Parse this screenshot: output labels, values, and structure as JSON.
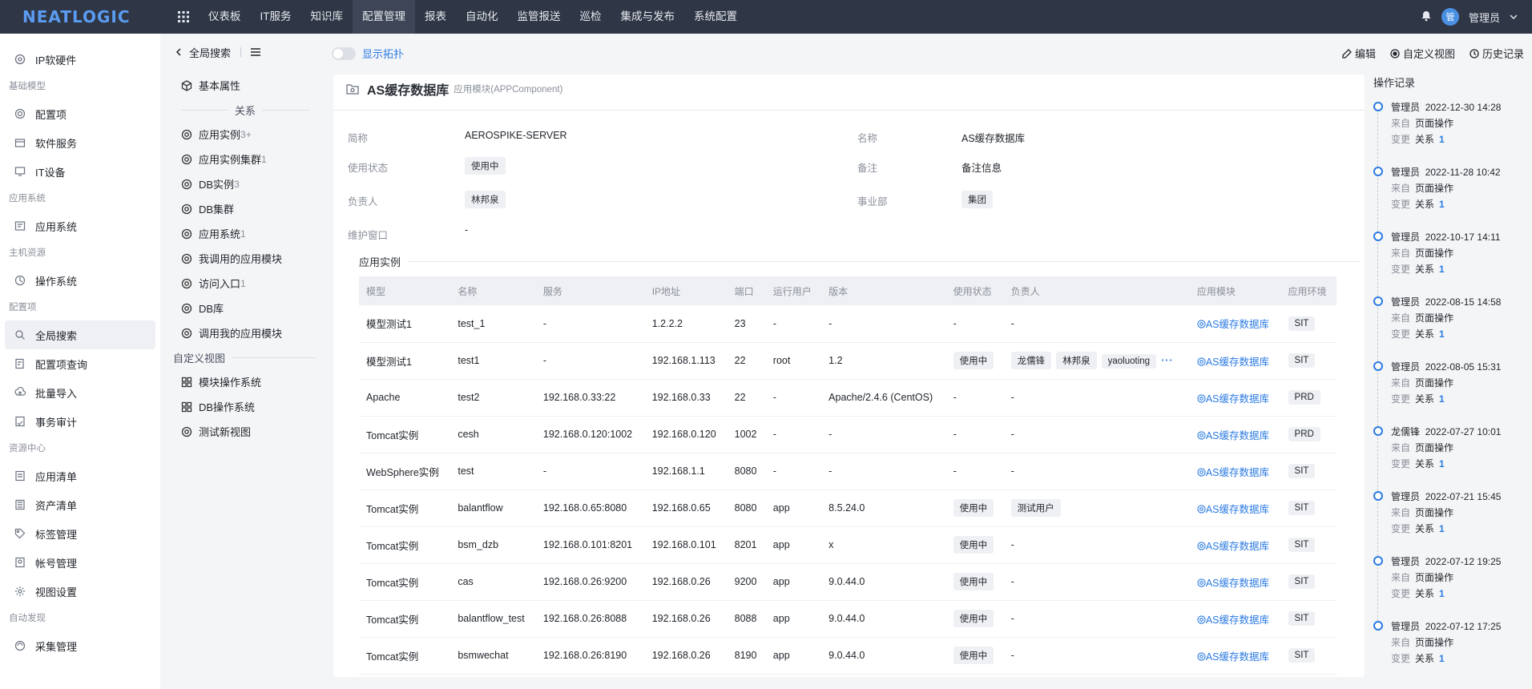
{
  "app": {
    "logo": "NEATLOGIC"
  },
  "topnav": [
    "仪表板",
    "IT服务",
    "知识库",
    "配置管理",
    "报表",
    "自动化",
    "监管报送",
    "巡检",
    "集成与发布",
    "系统配置"
  ],
  "user": {
    "avatar_text": "管",
    "name": "管理员"
  },
  "sidebar": {
    "top_item": "IP软硬件",
    "groups": [
      {
        "title": "基础模型",
        "items": [
          {
            "label": "配置项",
            "icon": "gear-icon"
          },
          {
            "label": "软件服务",
            "icon": "box-icon"
          },
          {
            "label": "IT设备",
            "icon": "monitor-icon"
          }
        ]
      },
      {
        "title": "应用系统",
        "items": [
          {
            "label": "应用系统",
            "icon": "app-icon"
          }
        ]
      },
      {
        "title": "主机资源",
        "items": [
          {
            "label": "操作系统",
            "icon": "os-icon"
          }
        ]
      },
      {
        "title": "配置项",
        "items": [
          {
            "label": "全局搜索",
            "icon": "search-icon",
            "active": true
          },
          {
            "label": "配置项查询",
            "icon": "query-icon"
          },
          {
            "label": "批量导入",
            "icon": "upload-icon"
          },
          {
            "label": "事务审计",
            "icon": "audit-icon"
          }
        ]
      },
      {
        "title": "资源中心",
        "items": [
          {
            "label": "应用清单",
            "icon": "list-icon"
          },
          {
            "label": "资产清单",
            "icon": "doc-icon"
          },
          {
            "label": "标签管理",
            "icon": "tag-icon"
          },
          {
            "label": "帐号管理",
            "icon": "account-icon"
          },
          {
            "label": "视图设置",
            "icon": "settings-icon"
          }
        ]
      },
      {
        "title": "自动发现",
        "items": [
          {
            "label": "采集管理",
            "icon": "collect-icon"
          }
        ]
      }
    ]
  },
  "breadcrumb": {
    "back_label": "全局搜索"
  },
  "relations_panel": {
    "basic_label": "基本属性",
    "relations_title": "关系",
    "relations": [
      {
        "label": "应用实例",
        "count": "3+"
      },
      {
        "label": "应用实例集群",
        "count": "1"
      },
      {
        "label": "DB实例",
        "count": "3"
      },
      {
        "label": "DB集群",
        "count": ""
      },
      {
        "label": "应用系统",
        "count": "1"
      },
      {
        "label": "我调用的应用模块",
        "count": ""
      },
      {
        "label": "访问入口",
        "count": "1"
      },
      {
        "label": "DB库",
        "count": ""
      },
      {
        "label": "调用我的应用模块",
        "count": ""
      }
    ],
    "custom_title": "自定义视图",
    "custom_views": [
      "模块操作系统",
      "DB操作系统",
      "测试新视图"
    ]
  },
  "toolbar": {
    "topology_label": "显示拓扑",
    "edit_label": "编辑",
    "custom_view_label": "自定义视图",
    "history_label": "历史记录"
  },
  "ci": {
    "title": "AS缓存数据库",
    "type": "应用模块(APPComponent)",
    "attributes": {
      "short_name": {
        "label": "简称",
        "value": "AEROSPIKE-SERVER"
      },
      "name": {
        "label": "名称",
        "value": "AS缓存数据库"
      },
      "status": {
        "label": "使用状态",
        "value": "使用中"
      },
      "remark": {
        "label": "备注",
        "value": "备注信息"
      },
      "owner": {
        "label": "负责人",
        "value": "林邦泉"
      },
      "dept": {
        "label": "事业部",
        "value": "集团"
      },
      "window": {
        "label": "维护窗口",
        "value": "-"
      }
    }
  },
  "instances": {
    "section_title": "应用实例",
    "columns": [
      "模型",
      "名称",
      "服务",
      "IP地址",
      "端口",
      "运行用户",
      "版本",
      "使用状态",
      "负责人",
      "应用模块",
      "应用环境"
    ],
    "rows": [
      {
        "model": "模型测试1",
        "name": "test_1",
        "service": "-",
        "ip": "1.2.2.2",
        "port": "23",
        "user": "-",
        "version": "-",
        "status": "-",
        "owners": [],
        "module": "AS缓存数据库",
        "env": "SIT"
      },
      {
        "model": "模型测试1",
        "name": "test1",
        "service": "-",
        "ip": "192.168.1.113",
        "port": "22",
        "user": "root",
        "version": "1.2",
        "status": "使用中",
        "owners": [
          "龙儒锋",
          "林邦泉",
          "yaoluoting"
        ],
        "more": "···",
        "module": "AS缓存数据库",
        "env": "SIT"
      },
      {
        "model": "Apache",
        "name": "test2",
        "service": "192.168.0.33:22",
        "ip": "192.168.0.33",
        "port": "22",
        "user": "-",
        "version": "Apache/2.4.6 (CentOS)",
        "status": "-",
        "owners": [],
        "module": "AS缓存数据库",
        "env": "PRD"
      },
      {
        "model": "Tomcat实例",
        "name": "cesh",
        "service": "192.168.0.120:1002",
        "ip": "192.168.0.120",
        "port": "1002",
        "user": "-",
        "version": "-",
        "status": "-",
        "owners": [],
        "module": "AS缓存数据库",
        "env": "PRD"
      },
      {
        "model": "WebSphere实例",
        "name": "test",
        "service": "-",
        "ip": "192.168.1.1",
        "port": "8080",
        "user": "-",
        "version": "-",
        "status": "-",
        "owners": [],
        "module": "AS缓存数据库",
        "env": "SIT"
      },
      {
        "model": "Tomcat实例",
        "name": "balantflow",
        "service": "192.168.0.65:8080",
        "ip": "192.168.0.65",
        "port": "8080",
        "user": "app",
        "version": "8.5.24.0",
        "status": "使用中",
        "owners": [
          "测试用户"
        ],
        "module": "AS缓存数据库",
        "env": "SIT"
      },
      {
        "model": "Tomcat实例",
        "name": "bsm_dzb",
        "service": "192.168.0.101:8201",
        "ip": "192.168.0.101",
        "port": "8201",
        "user": "app",
        "version": "x",
        "status": "使用中",
        "owners": [],
        "module": "AS缓存数据库",
        "env": "SIT"
      },
      {
        "model": "Tomcat实例",
        "name": "cas",
        "service": "192.168.0.26:9200",
        "ip": "192.168.0.26",
        "port": "9200",
        "user": "app",
        "version": "9.0.44.0",
        "status": "使用中",
        "owners": [],
        "module": "AS缓存数据库",
        "env": "SIT"
      },
      {
        "model": "Tomcat实例",
        "name": "balantflow_test",
        "service": "192.168.0.26:8088",
        "ip": "192.168.0.26",
        "port": "8088",
        "user": "app",
        "version": "9.0.44.0",
        "status": "使用中",
        "owners": [],
        "module": "AS缓存数据库",
        "env": "SIT"
      },
      {
        "model": "Tomcat实例",
        "name": "bsmwechat",
        "service": "192.168.0.26:8190",
        "ip": "192.168.0.26",
        "port": "8190",
        "user": "app",
        "version": "9.0.44.0",
        "status": "使用中",
        "owners": [],
        "module": "AS缓存数据库",
        "env": "SIT"
      }
    ]
  },
  "oplog": {
    "title": "操作记录",
    "from_label": "来自",
    "change_label": "变更",
    "entries": [
      {
        "user": "管理员",
        "time": "2022-12-30 14:28",
        "source": "页面操作",
        "change": "关系",
        "count": "1"
      },
      {
        "user": "管理员",
        "time": "2022-11-28 10:42",
        "source": "页面操作",
        "change": "关系",
        "count": "1"
      },
      {
        "user": "管理员",
        "time": "2022-10-17 14:11",
        "source": "页面操作",
        "change": "关系",
        "count": "1"
      },
      {
        "user": "管理员",
        "time": "2022-08-15 14:58",
        "source": "页面操作",
        "change": "关系",
        "count": "1"
      },
      {
        "user": "管理员",
        "time": "2022-08-05 15:31",
        "source": "页面操作",
        "change": "关系",
        "count": "1"
      },
      {
        "user": "龙儒锋",
        "time": "2022-07-27 10:01",
        "source": "页面操作",
        "change": "关系",
        "count": "1"
      },
      {
        "user": "管理员",
        "time": "2022-07-21 15:45",
        "source": "页面操作",
        "change": "关系",
        "count": "1"
      },
      {
        "user": "管理员",
        "time": "2022-07-12 19:25",
        "source": "页面操作",
        "change": "关系",
        "count": "1"
      },
      {
        "user": "管理员",
        "time": "2022-07-12 17:25",
        "source": "页面操作",
        "change": "关系",
        "count": "1"
      }
    ]
  }
}
